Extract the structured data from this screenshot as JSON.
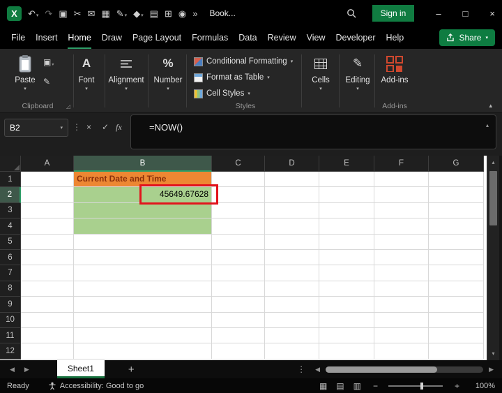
{
  "titlebar": {
    "title": "Book...",
    "sign_in": "Sign in"
  },
  "icons": {
    "logo": "X",
    "undo": "↶",
    "redo": "↷",
    "copy": "▣",
    "cut": "✂",
    "mail": "✉",
    "table": "▦",
    "pen": "✎",
    "shapes": "◆",
    "document": "▤",
    "merge": "⊞",
    "camera": "◉",
    "overflow": "»",
    "chevron_down": "▾",
    "chevron_up": "▴",
    "minimize": "–",
    "maximize": "□",
    "close": "×",
    "dots": "⋮",
    "cancel": "×",
    "check": "✓",
    "fx": "fx",
    "left_arrow": "◀",
    "right_arrow": "▶",
    "up_arrow": "▴",
    "down_arrow": "▾",
    "plus": "+",
    "minus": "−",
    "dialog_launcher": "◿",
    "percent": "%",
    "font_letter": "A",
    "view_normal": "▦",
    "view_layout": "▤",
    "view_break": "▥"
  },
  "menubar": {
    "tabs": [
      "File",
      "Insert",
      "Home",
      "Draw",
      "Page Layout",
      "Formulas",
      "Data",
      "Review",
      "View",
      "Developer",
      "Help"
    ],
    "share": "Share"
  },
  "ribbon": {
    "paste": "Paste",
    "font": "Font",
    "alignment": "Alignment",
    "number": "Number",
    "conditional_formatting": "Conditional Formatting",
    "format_as_table": "Format as Table",
    "cell_styles": "Cell Styles",
    "cells": "Cells",
    "editing": "Editing",
    "addins": "Add-ins",
    "group_clipboard": "Clipboard",
    "group_styles": "Styles",
    "group_addins": "Add-ins"
  },
  "formula_bar": {
    "name_box": "B2",
    "formula": "=NOW()"
  },
  "grid": {
    "columns": [
      "A",
      "B",
      "C",
      "D",
      "E",
      "F",
      "G"
    ],
    "rows": [
      "1",
      "2",
      "3",
      "4",
      "5",
      "6",
      "7",
      "8",
      "9",
      "10",
      "11",
      "12"
    ],
    "selected_column": "B",
    "selected_row": "2",
    "selected_cell": "B2",
    "cells": {
      "B1": {
        "text": "Current Date and Time",
        "bg": "#ED8733",
        "color": "#8A2F0B",
        "bold": true,
        "align": "left"
      },
      "B2": {
        "text": "45649.67628",
        "bg": "#A9D08E",
        "color": "#000000",
        "align": "right"
      },
      "B3": {
        "bg": "#A9D08E"
      },
      "B4": {
        "bg": "#A9D08E"
      }
    }
  },
  "sheet_bar": {
    "tab": "Sheet1"
  },
  "status_bar": {
    "ready": "Ready",
    "accessibility": "Accessibility: Good to go",
    "zoom": "100%"
  },
  "colors": {
    "excel_green": "#107C41",
    "header_fill_orange": "#ED8733",
    "header_text_red": "#8A2F0B",
    "cell_fill_green": "#A9D08E",
    "annotation_red": "#E2131C"
  }
}
